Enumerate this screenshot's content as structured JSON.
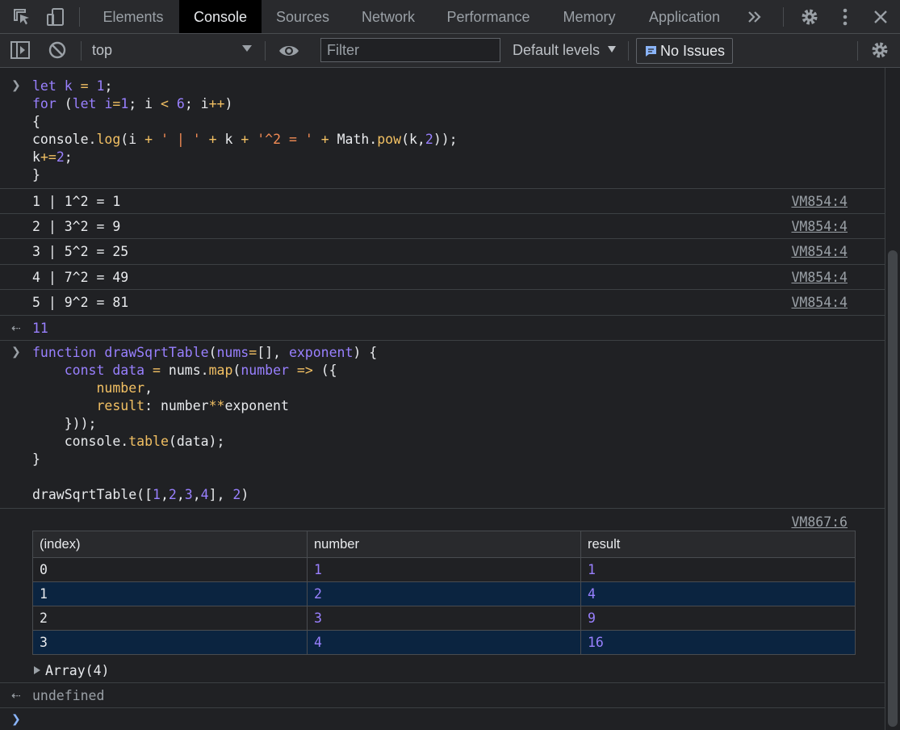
{
  "tabs": [
    "Elements",
    "Console",
    "Sources",
    "Network",
    "Performance",
    "Memory",
    "Application"
  ],
  "active_tab": "Console",
  "toolbar": {
    "context": "top",
    "filter_placeholder": "Filter",
    "levels": "Default levels",
    "issues": "No Issues"
  },
  "console": {
    "input1": {
      "lines": [
        "let k = 1;",
        "for (let i=1; i < 6; i++)",
        "{",
        "console.log(i + ' | ' + k + '^2 = ' + Math.pow(k,2));",
        "k+=2;",
        "}"
      ]
    },
    "logs": [
      {
        "text": "1 | 1^2 = 1",
        "source": "VM854:4"
      },
      {
        "text": "2 | 3^2 = 9",
        "source": "VM854:4"
      },
      {
        "text": "3 | 5^2 = 25",
        "source": "VM854:4"
      },
      {
        "text": "4 | 7^2 = 49",
        "source": "VM854:4"
      },
      {
        "text": "5 | 9^2 = 81",
        "source": "VM854:4"
      }
    ],
    "result1": "11",
    "input2": {
      "lines": [
        "function drawSqrtTable(nums=[], exponent) {",
        "    const data = nums.map(number => ({",
        "        number,",
        "        result: number**exponent",
        "    }));",
        "    console.table(data);",
        "}",
        "",
        "drawSqrtTable([1,2,3,4], 2)"
      ]
    },
    "table_source": "VM867:6",
    "table": {
      "headers": [
        "(index)",
        "number",
        "result"
      ],
      "rows": [
        [
          "0",
          "1",
          "1"
        ],
        [
          "1",
          "2",
          "4"
        ],
        [
          "2",
          "3",
          "9"
        ],
        [
          "3",
          "4",
          "16"
        ]
      ]
    },
    "array_label": "Array(4)",
    "result2": "undefined"
  },
  "colors": {
    "background": "#202124",
    "toolbar": "#292a2d",
    "keyword": "#9980ff",
    "string": "#f28b54",
    "function": "#f2c063",
    "row_highlight": "#0b2440",
    "issues_icon": "#8ab4f8"
  }
}
